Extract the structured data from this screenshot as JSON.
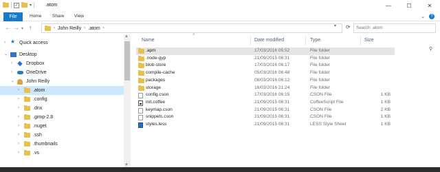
{
  "window": {
    "title": ".atom",
    "controls": [
      "—",
      "☐",
      "✕"
    ]
  },
  "ribbon": {
    "tabs": [
      "File",
      "Home",
      "Share",
      "View"
    ],
    "collapse_glyph": "⌄",
    "help_glyph": "?"
  },
  "address": {
    "path": [
      "John Reilly",
      ".atom"
    ],
    "search_placeholder": "Search .atom"
  },
  "navpane": {
    "items": [
      {
        "label": "Quick access",
        "level": 0,
        "icon": "star-icon"
      },
      {
        "label": "Desktop",
        "level": 0,
        "icon": "desktop-icon"
      },
      {
        "label": "Dropbox",
        "level": 1,
        "icon": "dropbox-icon"
      },
      {
        "label": "OneDrive",
        "level": 1,
        "icon": "onedrive-icon"
      },
      {
        "label": "John Reilly",
        "level": 1,
        "icon": "user-folder-icon"
      },
      {
        "label": ".atom",
        "level": 2,
        "icon": "folder-icon",
        "selected": true
      },
      {
        "label": ".config",
        "level": 2,
        "icon": "folder-icon"
      },
      {
        "label": ".dnx",
        "level": 2,
        "icon": "folder-icon"
      },
      {
        "label": ".gimp-2.8",
        "level": 2,
        "icon": "folder-icon"
      },
      {
        "label": ".nuget",
        "level": 2,
        "icon": "folder-icon"
      },
      {
        "label": ".ssh",
        "level": 2,
        "icon": "folder-icon"
      },
      {
        "label": ".thumbnails",
        "level": 2,
        "icon": "folder-icon"
      },
      {
        "label": ".vs",
        "level": 2,
        "icon": "folder-icon"
      }
    ]
  },
  "columns": {
    "name": "Name",
    "date": "Date modified",
    "type": "Type",
    "size": "Size"
  },
  "files": [
    {
      "name": ".apm",
      "date": "17/03/2016 05:52",
      "type": "File folder",
      "size": "",
      "icon": "folder-icon",
      "selected": true
    },
    {
      "name": ".node-gyp",
      "date": "21/09/2015 06:31",
      "type": "File folder",
      "size": "",
      "icon": "folder-icon"
    },
    {
      "name": "blob-store",
      "date": "17/03/2016 06:17",
      "type": "File folder",
      "size": "",
      "icon": "folder-icon"
    },
    {
      "name": "compile-cache",
      "date": "05/03/2016 06:48",
      "type": "File folder",
      "size": "",
      "icon": "folder-icon"
    },
    {
      "name": "packages",
      "date": "08/03/2016 06:12",
      "type": "File folder",
      "size": "",
      "icon": "folder-icon"
    },
    {
      "name": "storage",
      "date": "16/03/2016 21:24",
      "type": "File folder",
      "size": "",
      "icon": "folder-icon"
    },
    {
      "name": "config.cson",
      "date": "17/03/2016 06:15",
      "type": "CSON File",
      "size": "1 KB",
      "icon": "file-icon"
    },
    {
      "name": "init.coffee",
      "date": "21/09/2015 06:31",
      "type": "CoffeeScript File",
      "size": "1 KB",
      "icon": "coffeescript-file-icon"
    },
    {
      "name": "keymap.cson",
      "date": "21/09/2015 06:31",
      "type": "CSON File",
      "size": "2 KB",
      "icon": "file-icon"
    },
    {
      "name": "snippets.cson",
      "date": "21/09/2015 06:31",
      "type": "CSON File",
      "size": "1 KB",
      "icon": "file-icon"
    },
    {
      "name": "styles.less",
      "date": "21/09/2015 06:31",
      "type": "LESS Style Sheet",
      "size": "1 KB",
      "icon": "less-file-icon"
    }
  ]
}
